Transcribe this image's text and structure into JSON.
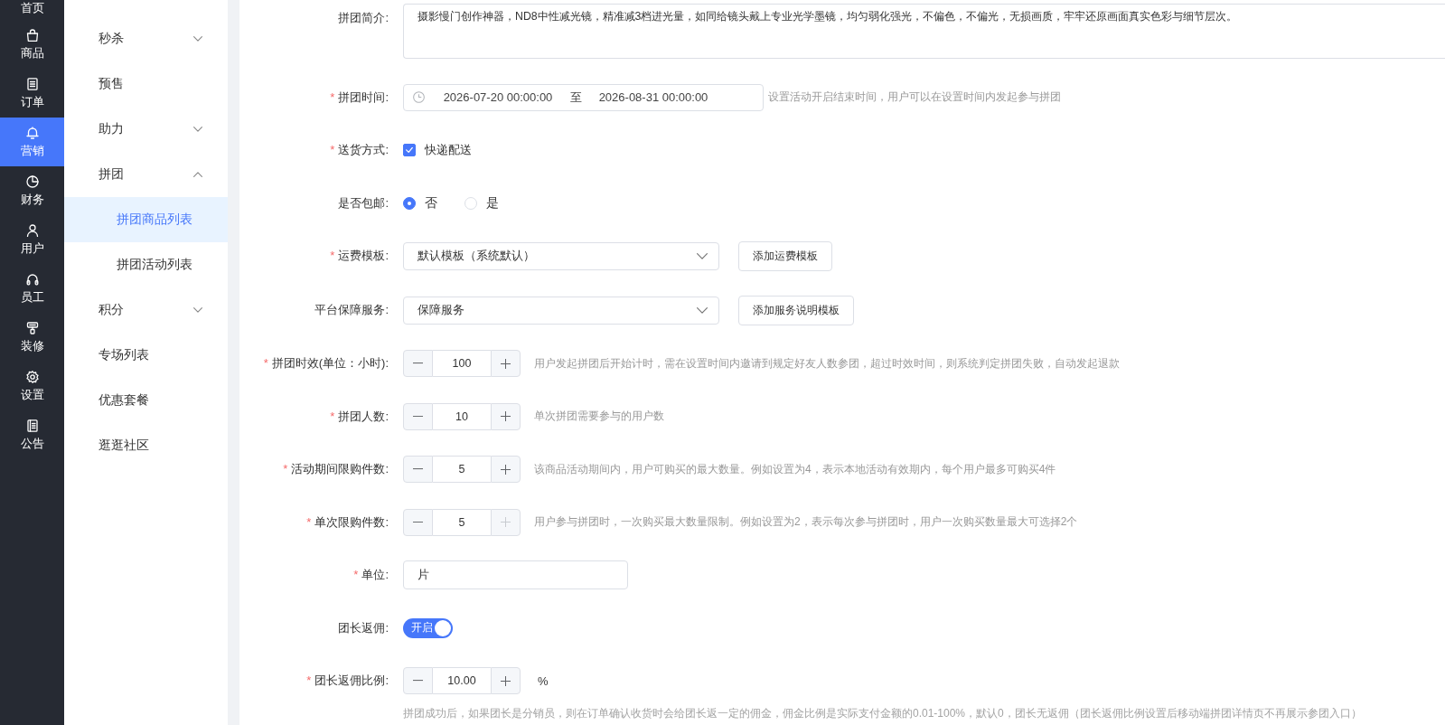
{
  "main_nav": {
    "items": [
      {
        "label": "首页",
        "selected": false
      },
      {
        "label": "商品",
        "selected": false
      },
      {
        "label": "订单",
        "selected": false
      },
      {
        "label": "营销",
        "selected": true
      },
      {
        "label": "财务",
        "selected": false
      },
      {
        "label": "用户",
        "selected": false
      },
      {
        "label": "员工",
        "selected": false
      },
      {
        "label": "装修",
        "selected": false
      },
      {
        "label": "设置",
        "selected": false
      },
      {
        "label": "公告",
        "selected": false
      }
    ]
  },
  "sub_nav": {
    "items": [
      {
        "kind": "group",
        "label": "秒杀",
        "expanded": false,
        "selected": false
      },
      {
        "kind": "link",
        "label": "预售",
        "selected": false
      },
      {
        "kind": "group",
        "label": "助力",
        "expanded": false,
        "selected": false
      },
      {
        "kind": "group",
        "label": "拼团",
        "expanded": true,
        "selected": false,
        "children": [
          {
            "label": "拼团商品列表",
            "selected": true
          },
          {
            "label": "拼团活动列表",
            "selected": false
          }
        ]
      },
      {
        "kind": "group",
        "label": "积分",
        "expanded": false,
        "selected": false
      },
      {
        "kind": "link",
        "label": "专场列表",
        "selected": false
      },
      {
        "kind": "link",
        "label": "优惠套餐",
        "selected": false
      },
      {
        "kind": "link",
        "label": "逛逛社区",
        "selected": false
      }
    ]
  },
  "form": {
    "fields": [
      {
        "kind": "textarea",
        "label": "拼团简介:",
        "value": "摄影慢门创作神器，ND8中性减光镜，精准减3档进光量，如同给镜头戴上专业光学墨镜，均匀弱化强光，不偏色，不偏光，无损画质，牢牢还原画面真实色彩与细节层次。"
      },
      {
        "kind": "daterange",
        "mark": "*",
        "label": "拼团时间:",
        "start": "2026-07-20 00:00:00",
        "separator": "至",
        "end": "2026-08-31 00:00:00",
        "hint": "设置活动开启结束时间，用户可以在设置时间内发起参与拼团"
      },
      {
        "kind": "checkbox",
        "mark": "*",
        "label": "送货方式:",
        "options": [
          {
            "label": "快递配送",
            "checked": true
          }
        ]
      },
      {
        "kind": "radio",
        "label": "是否包邮:",
        "options": [
          {
            "label": "否",
            "selected": true
          },
          {
            "label": "是",
            "selected": false
          }
        ]
      },
      {
        "kind": "select",
        "mark": "*",
        "label": "运费模板:",
        "value": "默认模板（系统默认）",
        "button": "添加运费模板"
      },
      {
        "kind": "select",
        "label": "平台保障服务:",
        "value": "保障服务",
        "button": "添加服务说明模板"
      },
      {
        "kind": "stepper",
        "mark": "*",
        "label": "拼团时效(单位：小时):",
        "value": "100",
        "plus_disabled": false,
        "hint": "用户发起拼团后开始计时，需在设置时间内邀请到规定好友人数参团，超过时效时间，则系统判定拼团失败，自动发起退款"
      },
      {
        "kind": "stepper",
        "mark": "*",
        "label": "拼团人数:",
        "value": "10",
        "plus_disabled": false,
        "hint": "单次拼团需要参与的用户数"
      },
      {
        "kind": "stepper",
        "mark": "*",
        "label": "活动期间限购件数:",
        "value": "5",
        "plus_disabled": false,
        "hint": "该商品活动期间内，用户可购买的最大数量。例如设置为4，表示本地活动有效期内，每个用户最多可购买4件"
      },
      {
        "kind": "stepper",
        "mark": "*",
        "label": "单次限购件数:",
        "value": "5",
        "plus_disabled": true,
        "hint": "用户参与拼团时，一次购买最大数量限制。例如设置为2，表示每次参与拼团时，用户一次购买数量最大可选择2个"
      },
      {
        "kind": "input",
        "mark": "*",
        "label": "单位:",
        "value": "片"
      },
      {
        "kind": "switch",
        "label": "团长返佣:",
        "on": true,
        "text": "开启"
      },
      {
        "kind": "stepper",
        "mark": "*",
        "label": "团长返佣比例:",
        "value": "10.00",
        "plus_disabled": false,
        "suffix": "%",
        "note": "拼团成功后，如果团长是分销员，则在订单确认收货时会给团长返一定的佣金，佣金比例是实际支付金额的0.01-100%，默认0，团长无返佣（团长返佣比例设置后移动端拼团详情页不再展示参团入口）"
      }
    ]
  }
}
